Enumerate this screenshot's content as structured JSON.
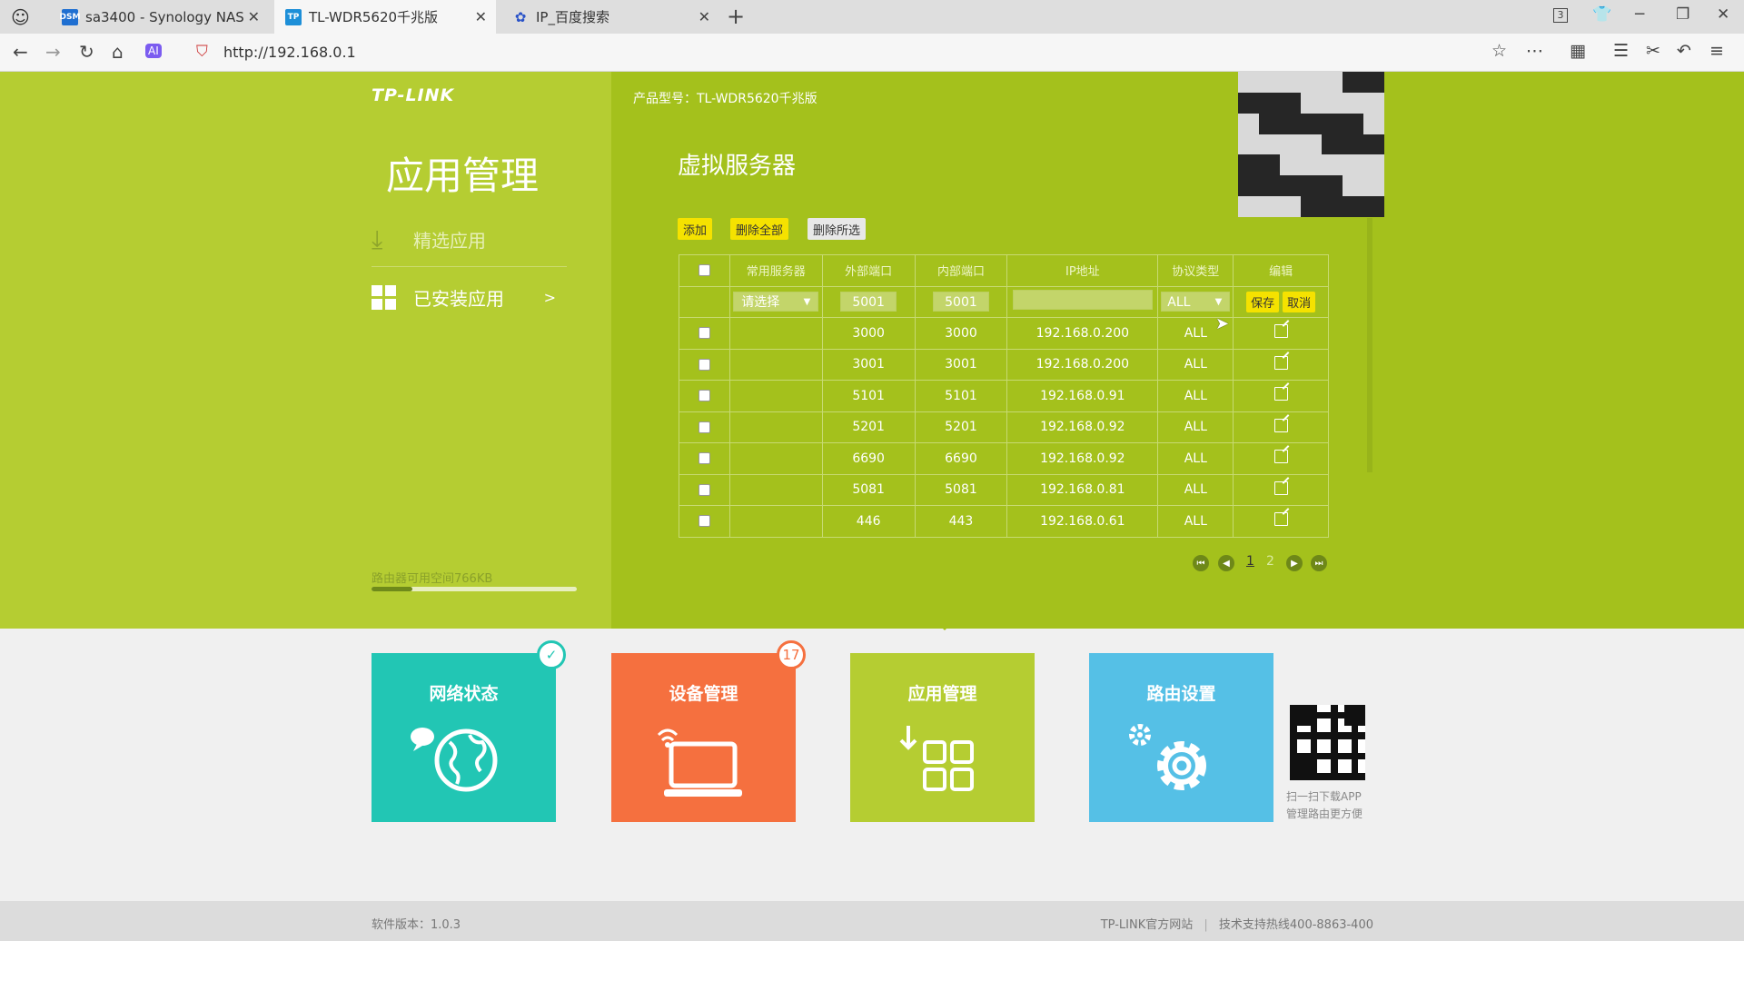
{
  "browser": {
    "tabs": [
      {
        "title": "sa3400 - Synology NAS",
        "icon": "DSM"
      },
      {
        "title": "TL-WDR5620千兆版",
        "icon": "TP"
      },
      {
        "title": "IP_百度搜索",
        "icon": "baidu-icon"
      }
    ],
    "tab_count": "3",
    "url": "http://192.168.0.1"
  },
  "sidebar": {
    "logo": "TP-LINK",
    "title": "应用管理",
    "menu": [
      {
        "label": "精选应用",
        "icon": "download-icon"
      },
      {
        "label": "已安装应用",
        "icon": "grid-icon",
        "arrow": ">"
      }
    ],
    "storage_text": "路由器可用空间766KB",
    "storage_fraction": 0.2
  },
  "main": {
    "model": "产品型号：TL-WDR5620千兆版",
    "title": "虚拟服务器",
    "buttons": {
      "add": "添加",
      "delete_all": "删除全部",
      "delete_selected": "删除所选"
    },
    "table": {
      "headers": [
        "常用服务器",
        "外部端口",
        "内部端口",
        "IP地址",
        "协议类型",
        "编辑"
      ],
      "edit_row": {
        "service": "请选择",
        "external_port": "5001",
        "internal_port": "5001",
        "ip": "",
        "protocol": "ALL",
        "save": "保存",
        "cancel": "取消"
      },
      "rows": [
        {
          "service": "",
          "ext": "3000",
          "int": "3000",
          "ip": "192.168.0.200",
          "proto": "ALL"
        },
        {
          "service": "",
          "ext": "3001",
          "int": "3001",
          "ip": "192.168.0.200",
          "proto": "ALL"
        },
        {
          "service": "",
          "ext": "5101",
          "int": "5101",
          "ip": "192.168.0.91",
          "proto": "ALL"
        },
        {
          "service": "",
          "ext": "5201",
          "int": "5201",
          "ip": "192.168.0.92",
          "proto": "ALL"
        },
        {
          "service": "",
          "ext": "6690",
          "int": "6690",
          "ip": "192.168.0.92",
          "proto": "ALL"
        },
        {
          "service": "",
          "ext": "5081",
          "int": "5081",
          "ip": "192.168.0.81",
          "proto": "ALL"
        },
        {
          "service": "",
          "ext": "446",
          "int": "443",
          "ip": "192.168.0.61",
          "proto": "ALL"
        }
      ]
    },
    "pagination": {
      "pages": [
        "1",
        "2"
      ],
      "current": "1"
    }
  },
  "tiles": [
    {
      "label": "网络状态",
      "color": "#22c6b4",
      "badge": "✓"
    },
    {
      "label": "设备管理",
      "color": "#f5703f",
      "badge": "17"
    },
    {
      "label": "应用管理",
      "color": "#b5cd32",
      "badge": ""
    },
    {
      "label": "路由设置",
      "color": "#55c0e6",
      "badge": ""
    }
  ],
  "qr_caption": [
    "扫一扫下载APP",
    "管理路由更方便"
  ],
  "footer": {
    "version": "软件版本：1.0.3",
    "official_site": "TP-LINK官方网站",
    "hotline": "技术支持热线400-8863-400"
  }
}
